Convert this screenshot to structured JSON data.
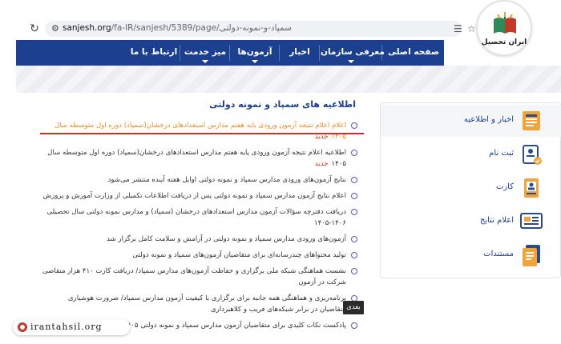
{
  "browser": {
    "url_host": "sanjesh.org",
    "url_path": "/fa-IR/sanjesh/5389/page/سمپاد-و-نمونه-دولتی"
  },
  "logo": {
    "text": "ایران تحصیل"
  },
  "nav": {
    "items": [
      {
        "label": "صفحه اصلی",
        "has_caret": false
      },
      {
        "label": "معرفی سازمان",
        "has_caret": true
      },
      {
        "label": "اخبار",
        "has_caret": false
      },
      {
        "label": "آزمون‌ها",
        "has_caret": true
      },
      {
        "label": "میز خدمت",
        "has_caret": true
      },
      {
        "label": "ارتباط با ما",
        "has_caret": false
      }
    ]
  },
  "sidebar": {
    "items": [
      {
        "label": "اخبار و اطلاعیه",
        "icon": "news-icon"
      },
      {
        "label": "ثبت نام",
        "icon": "registration-icon"
      },
      {
        "label": "کارت",
        "icon": "card-icon"
      },
      {
        "label": "اعلام نتایج",
        "icon": "results-icon"
      },
      {
        "label": "مستندات",
        "icon": "documents-icon"
      }
    ]
  },
  "main": {
    "title": "اطلاعیه های سمپاد و نمونه دولتی",
    "new_badge": "جدید",
    "next_label": "بعدی",
    "news": [
      {
        "text": "اعلام اعلام نتیجه آزمون ورودی پایه هفتم مدارس استعدادهای درخشان(سمپاد) دوره اول متوسطه سال ۱۴۰۵",
        "is_new": true
      },
      {
        "text": "اطلاعیه اعلام نتیجه آزمون ورودی پایه هفتم مدارس استعدادهای درخشان(سمپاد) دوره اول متوسطه سال ۱۴۰۵",
        "is_new": true
      },
      {
        "text": "نتایج آزمون‌های ورودی مدارس سمپاد و نمونه دولتی اوایل هفته آینده منتشر می‌شود",
        "is_new": false
      },
      {
        "text": "اعلام نتایج آزمون مدارس سمپاد و نمونه دولتی پس از دریافت اطلاعات تکمیلی از وزارت آموزش و پرورش",
        "is_new": false
      },
      {
        "text": "دریافت دفترچه سؤالات آزمون مدارس استعدادهای درخشان (سمپاد) و مدارس نمونه دولتی سال تحصیلی ۱۴۰۶-۱۴۰۵",
        "is_new": false
      },
      {
        "text": "آزمون‌های ورودی مدارس سمپاد و نمونه دولتی در آرامش و سلامت کامل برگزار شد",
        "is_new": false
      },
      {
        "text": "تولید محتواهای چندرسانه‌ای برای متقاضیان آزمون‌های سمپاد و نمونه دولتی",
        "is_new": false
      },
      {
        "text": "نشست هماهنگی شبکه ملی برگزاری و حفاظت آزمون‌های مدارس سمپاد/ دریافت کارت ۴۱۰ هزار متقاضی شرکت در آزمون",
        "is_new": false
      },
      {
        "text": "برنامه‌ریزی و هماهنگی همه جانبه برای برگزاری با کیفیت آزمون مدارس سمپاد/ ضرورت هوشیاری متقاضیان در برابر شبکه‌های فریب و کلاهبرداری",
        "is_new": false
      },
      {
        "text": "پادکست نکات کلیدی برای متقاضیان آزمون مدارس سمپاد و نمونه دولتی ۱۴۰۵",
        "is_new": false
      }
    ]
  },
  "watermark": {
    "text": "irantahsil.org"
  },
  "colors": {
    "nav_bg": "#1d3f8f",
    "highlight_orange": "#f08a24",
    "new_red": "#e0341a",
    "underline_red": "#d62b2b"
  }
}
